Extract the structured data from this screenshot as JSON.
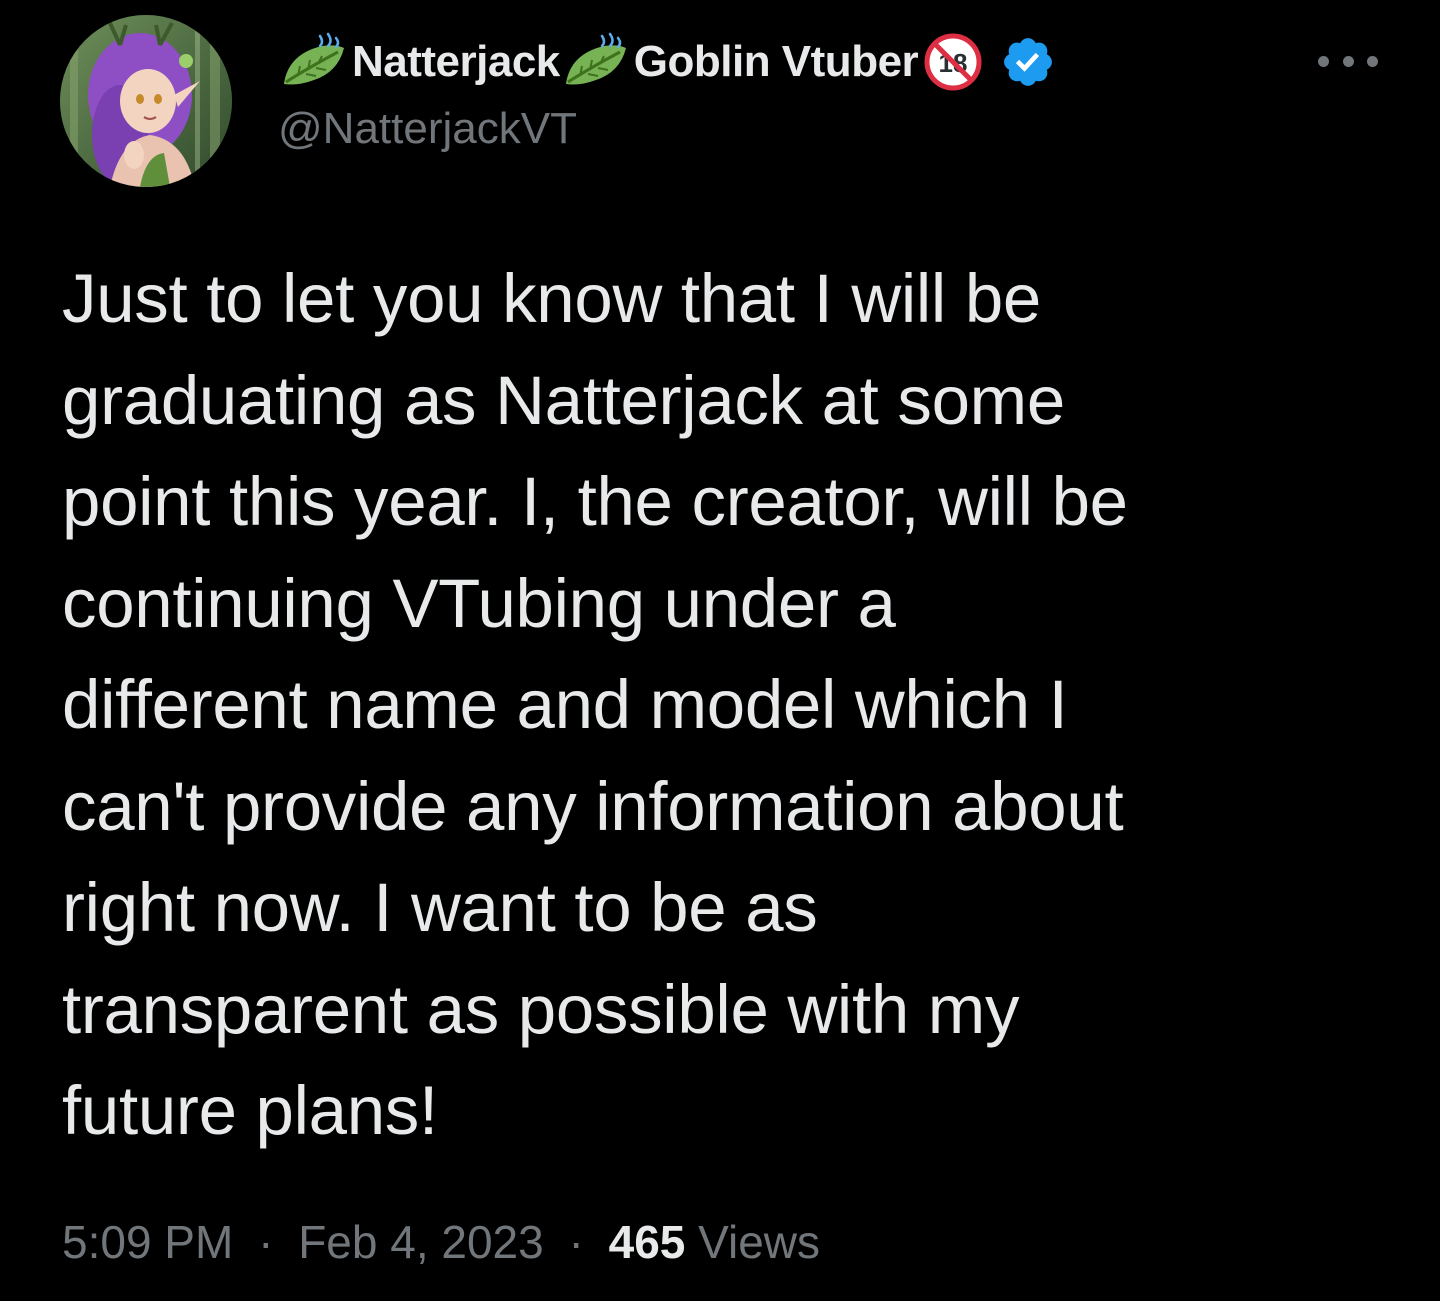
{
  "author": {
    "display_name_part1": "Natterjack",
    "display_name_part2": "Goblin Vtuber",
    "age_badge_text": "18",
    "handle": "@NatterjackVT",
    "avatar_icon": "avatar-image",
    "name_emoji_icon": "leaf-fluttering-in-wind-icon",
    "verified_icon": "verified-badge-icon",
    "verified_color": "#1d9bf0"
  },
  "more_menu_icon": "more-options-icon",
  "tweet": {
    "lines": [
      "Just to let you know that I will be",
      "graduating as Natterjack at some",
      "point this year. I, the creator, will be",
      "continuing VTubing under a",
      "different name and model which I",
      "can't provide any information about",
      "right now. I want to be as",
      "transparent as possible with my",
      "future plans!"
    ]
  },
  "meta": {
    "time": "5:09 PM",
    "date": "Feb 4, 2023",
    "separator": "·",
    "views_count": "465",
    "views_label": "Views"
  },
  "colors": {
    "background": "#000000",
    "primary_text": "#e7e9ea",
    "secondary_text": "#71767b"
  }
}
